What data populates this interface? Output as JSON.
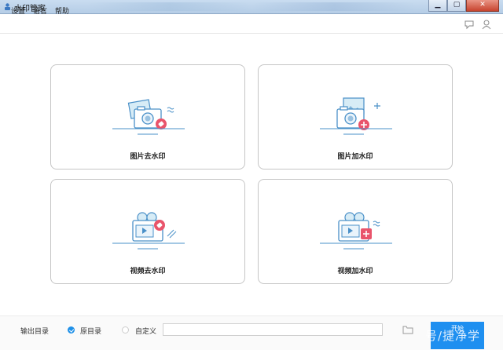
{
  "window": {
    "title": "水印管家"
  },
  "menu": {
    "settings": "设置",
    "language": "语言",
    "help": "帮助"
  },
  "cards": [
    {
      "label": "图片去水印",
      "icon": "photo-remove-watermark-icon"
    },
    {
      "label": "图片加水印",
      "icon": "photo-add-watermark-icon"
    },
    {
      "label": "视频去水印",
      "icon": "video-remove-watermark-icon"
    },
    {
      "label": "视频加水印",
      "icon": "video-add-watermark-icon"
    }
  ],
  "output": {
    "label": "输出目录",
    "option_original": "原目录",
    "option_custom": "自定义",
    "path_value": "",
    "selected": "原目录"
  },
  "start_button": {
    "label": "开始"
  },
  "overlay_text": "号/捷净学",
  "colors": {
    "accent": "#1e8ff0",
    "icon_blue": "#4a90c8",
    "icon_red": "#e9546b"
  }
}
